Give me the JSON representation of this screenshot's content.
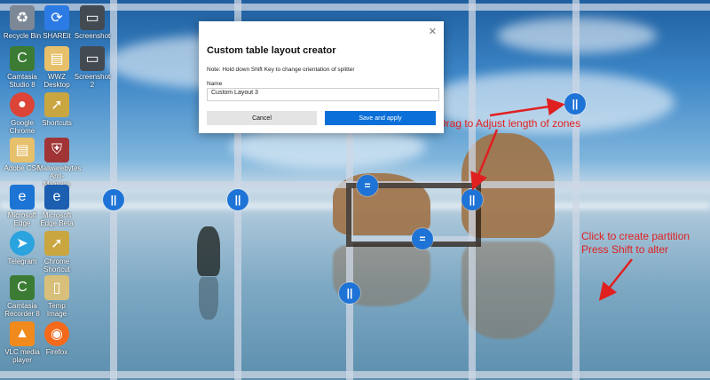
{
  "desktop_icons": [
    {
      "label": "Recycle Bin",
      "icon": "recycle-bin-icon",
      "color": "#7d8896"
    },
    {
      "label": "SHAREit",
      "icon": "shareit-icon",
      "color": "#2c7be5"
    },
    {
      "label": "Screenshot",
      "icon": "screenshot-icon",
      "color": "#444a52"
    },
    {
      "label": "Camtasia Studio 8",
      "icon": "camtasia-icon",
      "color": "#3c7b34"
    },
    {
      "label": "WWZ Desktop",
      "icon": "folder-icon",
      "color": "#e6c06a"
    },
    {
      "label": "Screenshot 2",
      "icon": "screenshot-icon",
      "color": "#444a52"
    },
    {
      "label": "Google Chrome",
      "icon": "chrome-icon",
      "color": "#db4437"
    },
    {
      "label": "Shortcuts",
      "icon": "shortcut-icon",
      "color": "#c9a640"
    },
    {
      "label": "Adobe CS6",
      "icon": "folder-icon",
      "color": "#e6c06a"
    },
    {
      "label": "Malwarebytes Anti-Malware",
      "icon": "shield-icon",
      "color": "#a13535"
    },
    {
      "label": "Microsoft Edge",
      "icon": "edge-icon",
      "color": "#1c74d4"
    },
    {
      "label": "Microsoft Edge Beta",
      "icon": "edge-beta-icon",
      "color": "#1c5fb0"
    },
    {
      "label": "Telegram",
      "icon": "telegram-icon",
      "color": "#2aa3de"
    },
    {
      "label": "Chrome Shortcut",
      "icon": "shortcut-icon",
      "color": "#c9a640"
    },
    {
      "label": "Camtasia Recorder 8",
      "icon": "camtasia-icon",
      "color": "#3c7b34"
    },
    {
      "label": "Temp Image",
      "icon": "file-icon",
      "color": "#d8c07a"
    },
    {
      "label": "VLC media player",
      "icon": "vlc-icon",
      "color": "#f08a1c"
    },
    {
      "label": "Firefox",
      "icon": "firefox-icon",
      "color": "#f46a1a"
    }
  ],
  "dialog": {
    "title": "Custom table layout creator",
    "note": "Note: Hold down Shift Key to change orientation of splitter",
    "name_label": "Name",
    "name_value": "Custom Layout 3",
    "cancel_label": "Cancel",
    "save_label": "Save and apply",
    "close_glyph": "✕",
    "accent_color": "#0a6fd8"
  },
  "handles": {
    "vertical_glyph": "||",
    "horizontal_glyph": "="
  },
  "annotations": {
    "drag": "Drag to Adjust length of zones",
    "click_line1": "Click to create partition",
    "click_line2": "Press Shift to alter",
    "color": "#e02020"
  }
}
